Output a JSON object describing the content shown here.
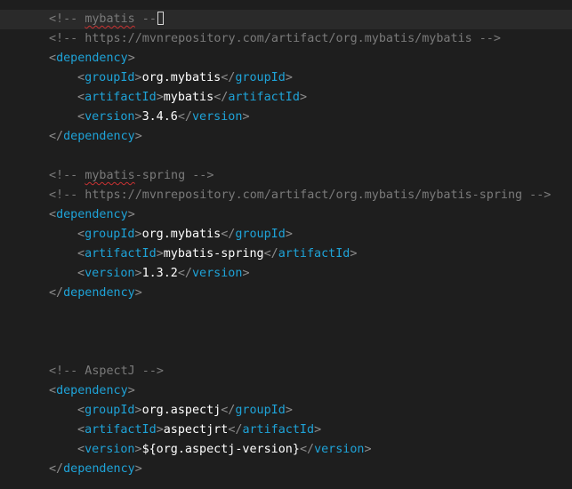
{
  "editor": {
    "block1": {
      "comment_open": "<!-- ",
      "comment_name": "mybatis",
      "comment_close": " --",
      "url_comment": "<!-- https://mvnrepository.com/artifact/org.mybatis/mybatis -->",
      "dependency_tag": "dependency",
      "group_tag": "groupId",
      "group_value": "org.mybatis",
      "artifact_tag": "artifactId",
      "artifact_value": "mybatis",
      "version_tag": "version",
      "version_value": "3.4.6"
    },
    "block2": {
      "comment_open": "<!-- ",
      "comment_name": "mybatis",
      "comment_rest": "-spring -->",
      "url_comment": "<!-- https://mvnrepository.com/artifact/org.mybatis/mybatis-spring -->",
      "dependency_tag": "dependency",
      "group_tag": "groupId",
      "group_value": "org.mybatis",
      "artifact_tag": "artifactId",
      "artifact_value": "mybatis-spring",
      "version_tag": "version",
      "version_value": "1.3.2"
    },
    "block3": {
      "comment": "<!-- AspectJ -->",
      "dependency_tag": "dependency",
      "group_tag": "groupId",
      "group_value": "org.aspectj",
      "artifact_tag": "artifactId",
      "artifact_value": "aspectjrt",
      "version_tag": "version",
      "version_value": "${org.aspectj-version}"
    },
    "colors": {
      "background": "#1e1e1e",
      "current_line": "#2a2a2a",
      "comment": "#7a7a7a",
      "tag": "#1ea3d8",
      "bracket": "#8c8c8c",
      "text": "#ffffff",
      "spell_error": "#c83232"
    }
  }
}
